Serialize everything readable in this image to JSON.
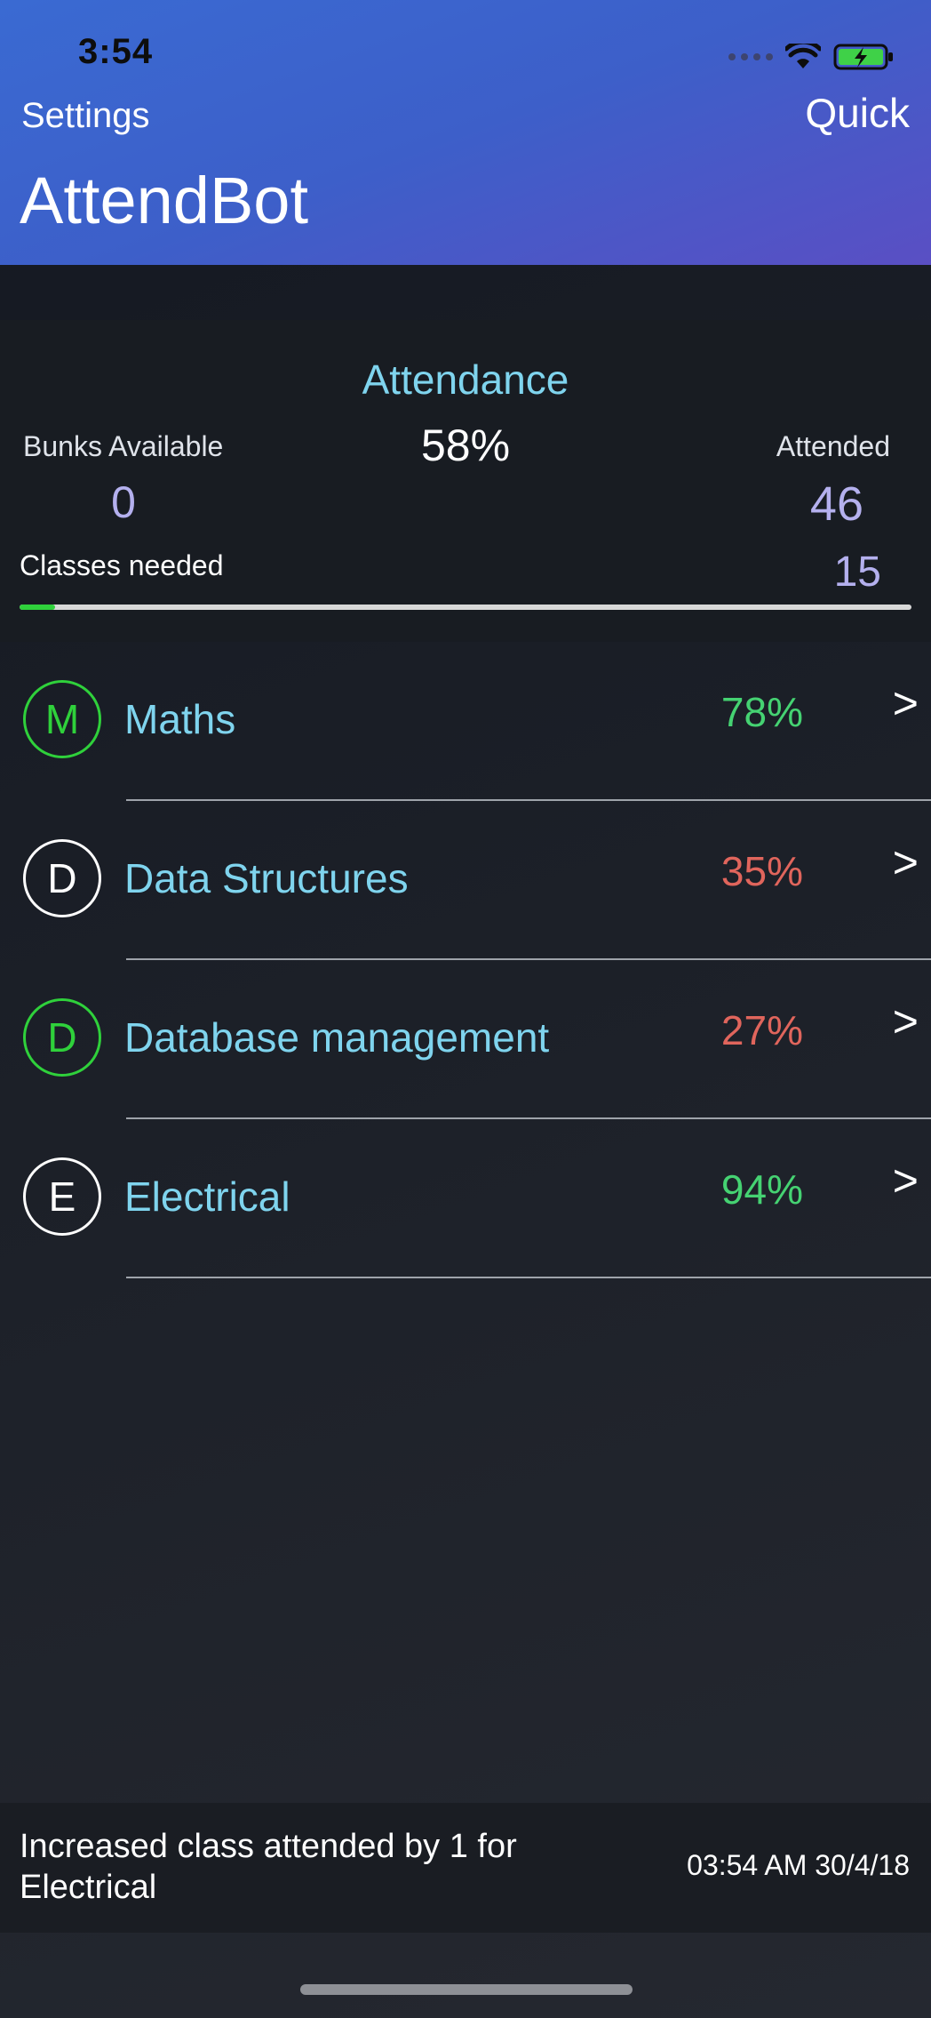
{
  "status_bar": {
    "time": "3:54"
  },
  "header": {
    "settings_label": "Settings",
    "quick_label": "Quick",
    "title": "AttendBot"
  },
  "summary": {
    "title": "Attendance",
    "percent": "58%",
    "bunks_label": "Bunks Available",
    "bunks_value": "0",
    "attended_label": "Attended",
    "attended_value": "46",
    "needed_label": "Classes needed",
    "needed_value": "15",
    "progress_fraction": 0.04
  },
  "subjects": [
    {
      "initial": "M",
      "name": "Maths",
      "percent": "78%",
      "status": "good",
      "badge": "green"
    },
    {
      "initial": "D",
      "name": "Data Structures",
      "percent": "35%",
      "status": "bad",
      "badge": "white"
    },
    {
      "initial": "D",
      "name": "Database management",
      "percent": "27%",
      "status": "bad",
      "badge": "green"
    },
    {
      "initial": "E",
      "name": "Electrical",
      "percent": "94%",
      "status": "good",
      "badge": "white"
    }
  ],
  "chevron_glyph": ">",
  "toast": {
    "message": "Increased class attended by 1 for Electrical",
    "timestamp": "03:54 AM 30/4/18"
  },
  "colors": {
    "header_start": "#3a6ad2",
    "header_end": "#5a4fc4",
    "accent_cyan": "#7fd4ee",
    "value_lavender": "#b4b0ee",
    "good_green": "#45d272",
    "bad_red": "#e0655c",
    "badge_green": "#2fd13b"
  }
}
